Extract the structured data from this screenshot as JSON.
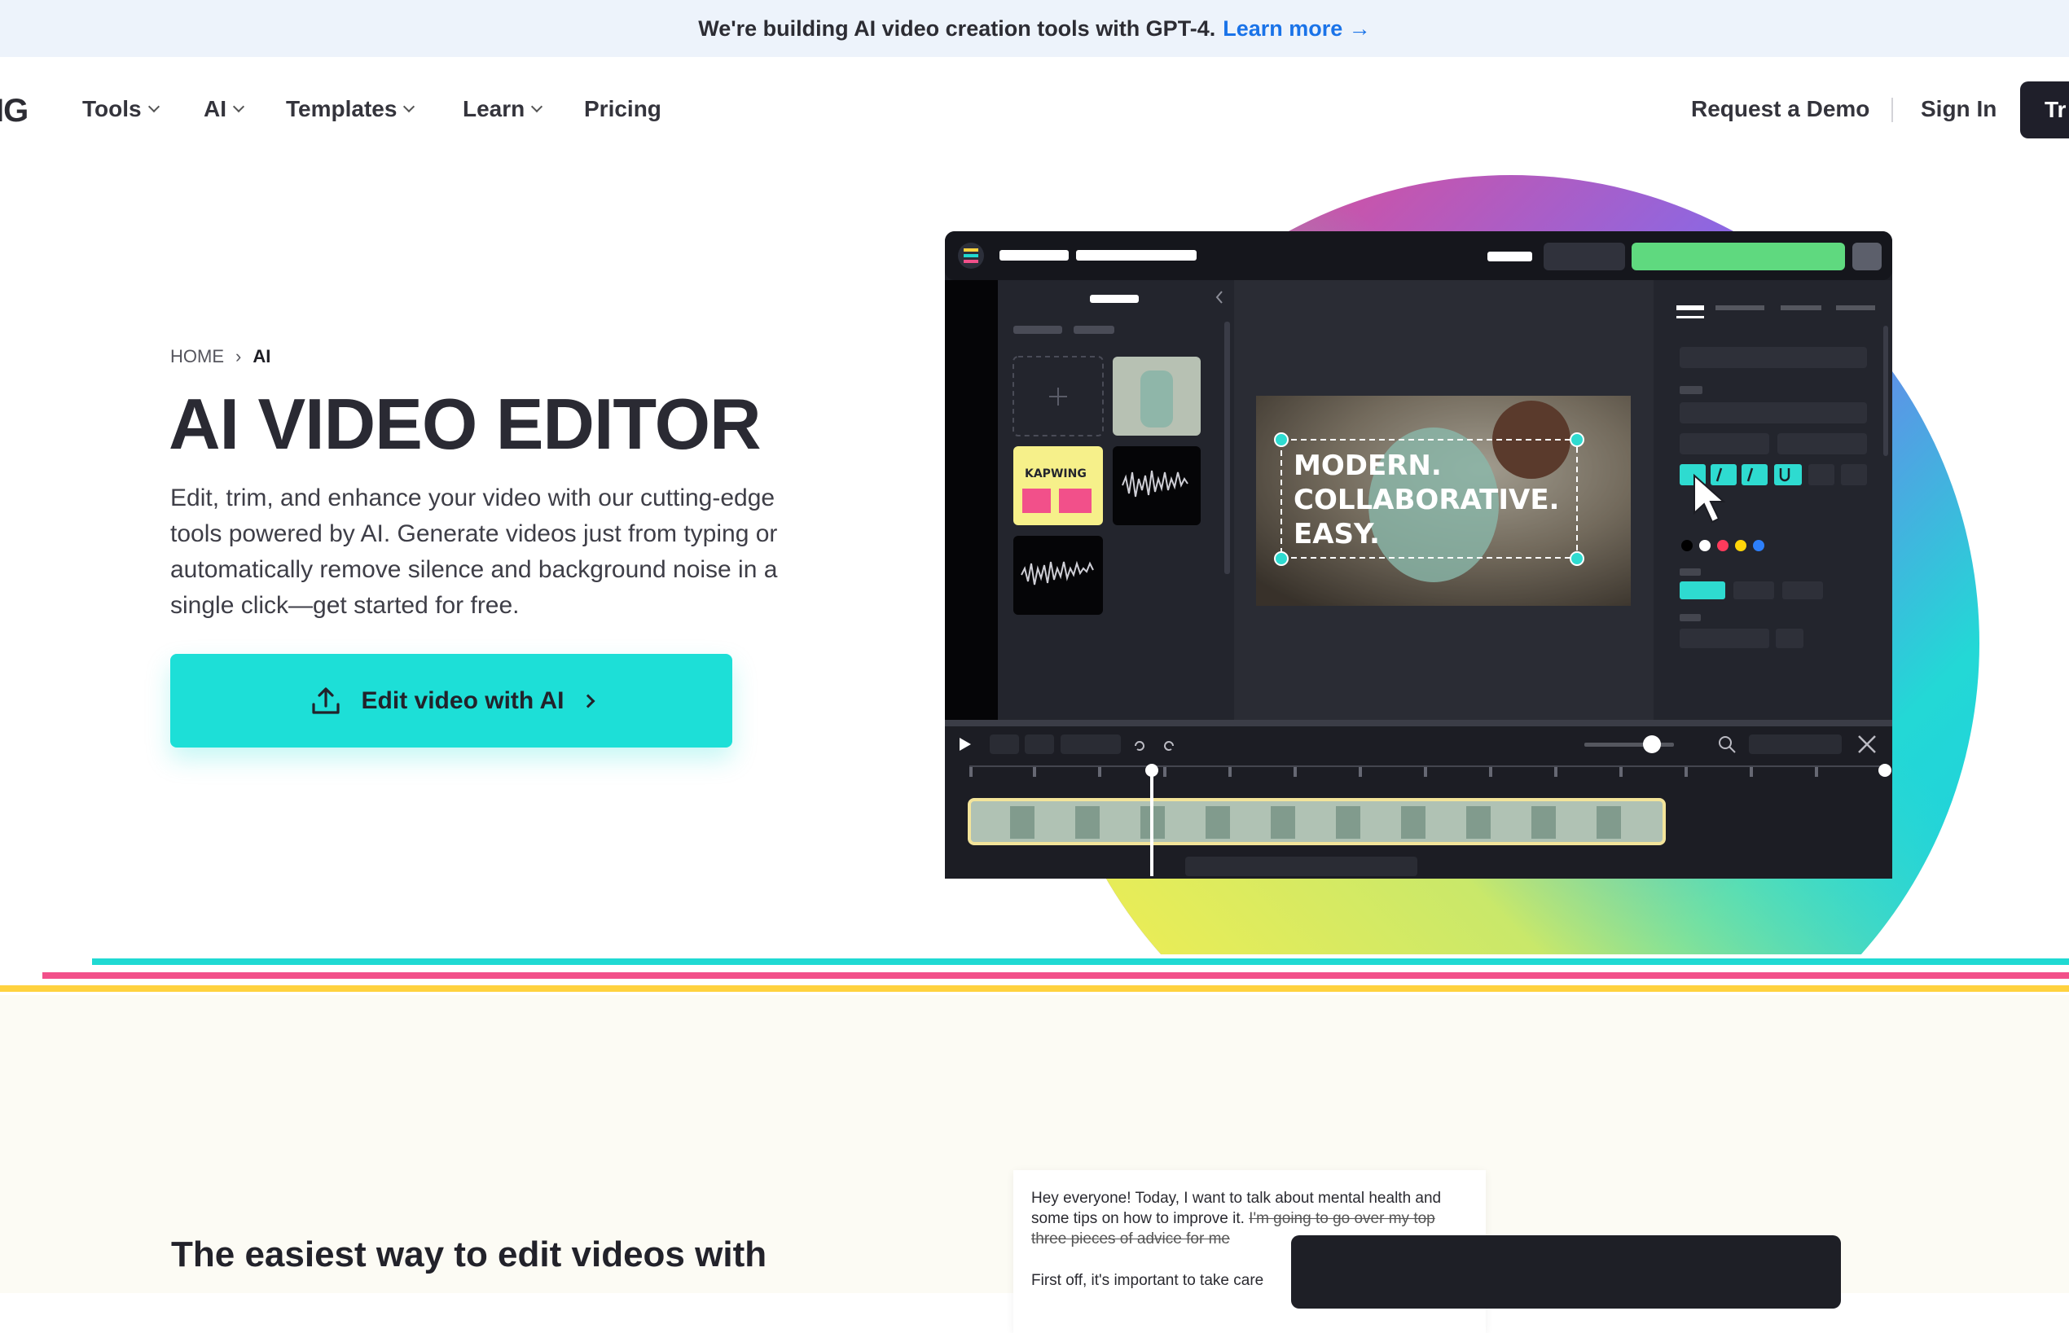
{
  "banner": {
    "text": "We're building AI video creation tools with GPT-4.",
    "link": "Learn more →"
  },
  "nav": {
    "logo_fragment": "IG",
    "items": [
      {
        "label": "Tools",
        "dropdown": true
      },
      {
        "label": "AI",
        "dropdown": true
      },
      {
        "label": "Templates",
        "dropdown": true
      },
      {
        "label": "Learn",
        "dropdown": true
      },
      {
        "label": "Pricing",
        "dropdown": false
      }
    ],
    "request_demo": "Request a Demo",
    "sign_in": "Sign In",
    "try_fragment": "Tr"
  },
  "hero": {
    "breadcrumb": {
      "home": "HOME",
      "separator": "›",
      "current": "AI"
    },
    "title": "AI VIDEO EDITOR",
    "description": "Edit, trim, and enhance your video with our cutting-edge tools powered by AI. Generate videos just from typing or automatically remove silence and background noise in a single click—get started for free.",
    "cta_label": "Edit video with AI"
  },
  "mockup": {
    "caption_lines": [
      "MODERN.",
      "COLLABORATIVE.",
      "EASY."
    ],
    "kapwing_card_text": "KAPWING",
    "colors": [
      "#000000",
      "#ffffff",
      "#ff3b5c",
      "#ffd60a",
      "#2d7ff9"
    ]
  },
  "lower": {
    "heading": "The easiest way to edit videos with",
    "transcript": {
      "line1": "Hey everyone! Today, I want to talk about mental health and some tips on how to improve it.",
      "struck": "I'm going to go over my top three pieces of advice for me",
      "line2": "First off, it's important to take care"
    }
  },
  "colors": {
    "accent": "#1ddfd7",
    "link": "#1a73e8",
    "banner_bg": "#edf3fb",
    "stripe_teal": "#20d9d2",
    "stripe_pink": "#f2508a",
    "stripe_yellow": "#ffd23f"
  }
}
